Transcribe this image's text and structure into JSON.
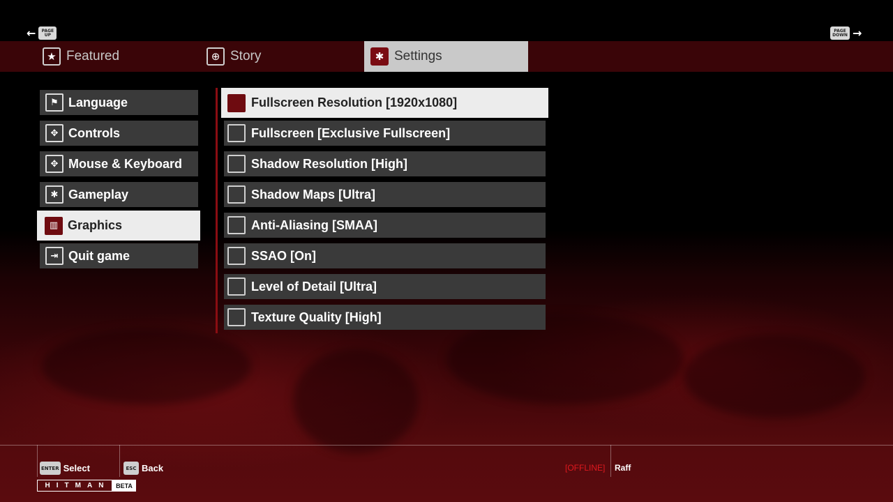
{
  "nav": {
    "prev_key": "PAGE UP",
    "next_key": "PAGE DOWN",
    "prev_arrow": "←",
    "next_arrow": "→"
  },
  "tabs": [
    {
      "label": "Featured",
      "icon": "star-icon",
      "glyph": "★"
    },
    {
      "label": "Story",
      "icon": "globe-icon",
      "glyph": "⊕"
    },
    {
      "label": "Settings",
      "icon": "gear-icon",
      "glyph": "✱"
    }
  ],
  "active_tab": "Settings",
  "sidebar": {
    "items": [
      {
        "label": "Language",
        "icon": "flag-icon",
        "glyph": "⚑"
      },
      {
        "label": "Controls",
        "icon": "dpad-icon",
        "glyph": "✥"
      },
      {
        "label": "Mouse & Keyboard",
        "icon": "dpad-icon",
        "glyph": "✥"
      },
      {
        "label": "Gameplay",
        "icon": "gear-icon",
        "glyph": "✱"
      },
      {
        "label": "Graphics",
        "icon": "graph-icon",
        "glyph": "▥"
      },
      {
        "label": "Quit game",
        "icon": "exit-icon",
        "glyph": "⇥"
      }
    ],
    "active": "Graphics"
  },
  "options": [
    "Fullscreen Resolution [1920x1080]",
    "Fullscreen [Exclusive Fullscreen]",
    "Shadow Resolution [High]",
    "Shadow Maps [Ultra]",
    "Anti-Aliasing [SMAA]",
    "SSAO [On]",
    "Level of Detail [Ultra]",
    "Texture Quality [High]"
  ],
  "footer": {
    "select_key": "ENTER",
    "select_label": "Select",
    "back_key": "ESC",
    "back_label": "Back",
    "status": "[OFFLINE]",
    "username": "Raff",
    "logo_text": "HITMAN",
    "logo_badge": "BETA"
  },
  "colors": {
    "accent": "#6e0b10",
    "tab_bar": "#3a0508",
    "offline": "#e0181e"
  }
}
